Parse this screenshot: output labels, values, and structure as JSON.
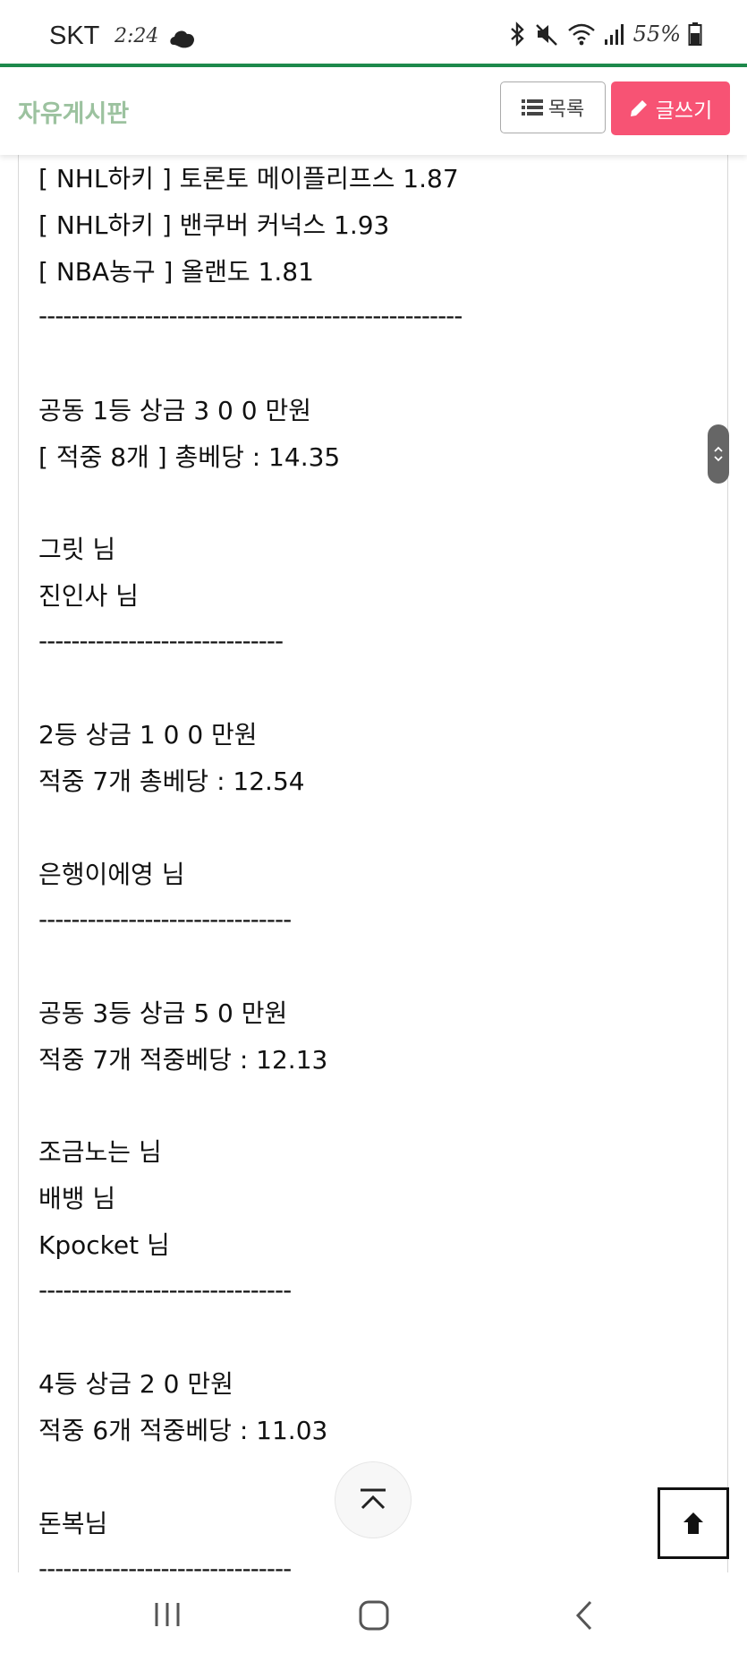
{
  "status_bar": {
    "carrier": "SKT",
    "time": "2:24",
    "battery": "55%"
  },
  "header": {
    "board_title": "자유게시판",
    "list_button": "목록",
    "write_button": "글쓰기"
  },
  "post_lines": [
    "[ NHL하키 ] 토론토 메이플리프스 1.87",
    "[ NHL하키 ] 밴쿠버 커넉스 1.93",
    "[ NBA농구 ] 올랜도 1.81",
    "----------------------------------------------------",
    "공동 1등 상금 3 0 0 만원",
    "[ 적중 8개 ] 총베당 : 14.35",
    "그릿 님",
    "진인사 님",
    "------------------------------",
    "2등 상금 1 0 0 만원",
    "적중 7개 총베당 : 12.54",
    "은행이에영 님",
    "-------------------------------",
    "공동 3등 상금 5 0 만원",
    "적중 7개 적중베당 : 12.13",
    "조금노는 님",
    "배뱅 님",
    "Kpocket 님",
    "-------------------------------",
    "4등 상금 2 0 만원",
    "적중 6개 적중베당 : 11.03",
    "돈복님",
    "-------------------------------"
  ],
  "colors": {
    "accent_green": "#1e8a4c",
    "title_green": "#9cc29f",
    "write_pink": "#f75374"
  }
}
